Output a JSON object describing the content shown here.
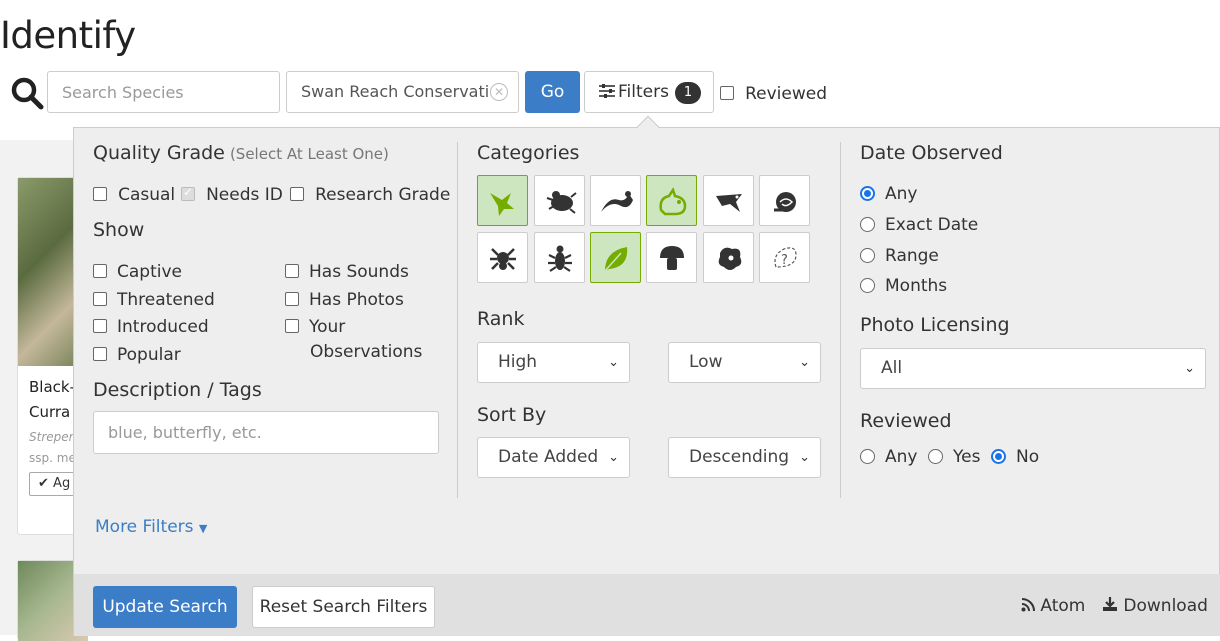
{
  "page": {
    "title": "Identify"
  },
  "search": {
    "species_placeholder": "Search Species",
    "place_value": "Swan Reach Conservati",
    "go_label": "Go",
    "filters_label": "Filters",
    "filters_count": "1",
    "reviewed_label": "Reviewed"
  },
  "background_card": {
    "title_line1": "Black-",
    "title_line2": "Curra",
    "sci_line1": "Streper",
    "sci_line2": "ssp. me",
    "agree_label": "Ag"
  },
  "filters": {
    "quality_grade": {
      "heading": "Quality Grade",
      "hint": "(Select At Least One)",
      "options": [
        {
          "label": "Casual",
          "checked": false
        },
        {
          "label": "Needs ID",
          "checked": true,
          "disabled": true
        },
        {
          "label": "Research Grade",
          "checked": false
        }
      ]
    },
    "show": {
      "heading": "Show",
      "left": [
        "Captive",
        "Threatened",
        "Introduced",
        "Popular"
      ],
      "right": [
        "Has Sounds",
        "Has Photos",
        "Your",
        "Observations"
      ]
    },
    "description": {
      "heading": "Description / Tags",
      "placeholder": "blue, butterfly, etc."
    },
    "more_filters": "More Filters",
    "categories": {
      "heading": "Categories",
      "icons": [
        {
          "name": "birds",
          "selected": true
        },
        {
          "name": "amphibians",
          "selected": false
        },
        {
          "name": "reptiles",
          "selected": false
        },
        {
          "name": "mammals",
          "selected": true
        },
        {
          "name": "ray-finned-fishes",
          "selected": false
        },
        {
          "name": "mollusks",
          "selected": false
        },
        {
          "name": "arachnids",
          "selected": false
        },
        {
          "name": "insects",
          "selected": false
        },
        {
          "name": "plants",
          "selected": true
        },
        {
          "name": "fungi",
          "selected": false
        },
        {
          "name": "protozoans",
          "selected": false
        },
        {
          "name": "unknown",
          "selected": false
        }
      ]
    },
    "rank": {
      "heading": "Rank",
      "high": "High",
      "low": "Low"
    },
    "sort_by": {
      "heading": "Sort By",
      "field": "Date Added",
      "order": "Descending"
    },
    "date_observed": {
      "heading": "Date Observed",
      "options": [
        "Any",
        "Exact Date",
        "Range",
        "Months"
      ],
      "selected": "Any"
    },
    "photo_licensing": {
      "heading": "Photo Licensing",
      "value": "All"
    },
    "reviewed": {
      "heading": "Reviewed",
      "options": [
        "Any",
        "Yes",
        "No"
      ],
      "selected": "No"
    },
    "footer": {
      "update_label": "Update Search",
      "reset_label": "Reset Search Filters",
      "atom_label": "Atom",
      "download_label": "Download"
    }
  },
  "colors": {
    "primary": "#3b7dc6",
    "category_selected": "#cde6bf",
    "category_border": "#74ac00"
  }
}
